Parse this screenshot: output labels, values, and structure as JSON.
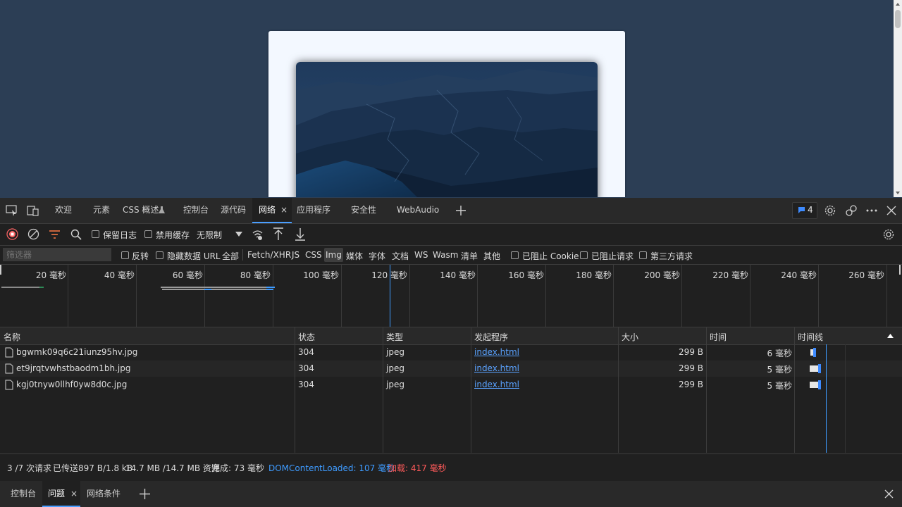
{
  "devtools": {
    "tabs": [
      {
        "label": "欢迎"
      },
      {
        "label": "元素"
      },
      {
        "label": "CSS 概述"
      },
      {
        "label": "控制台"
      },
      {
        "label": "源代码"
      },
      {
        "label": "网络",
        "active": true
      },
      {
        "label": "应用程序"
      },
      {
        "label": "安全性"
      },
      {
        "label": "WebAudio"
      }
    ],
    "issues_count": "4",
    "close_tab_symbol": "×"
  },
  "network_toolbar": {
    "preserve_log": "保留日志",
    "disable_cache": "禁用缓存",
    "throttling": "无限制"
  },
  "filter_bar": {
    "placeholder": "筛选器",
    "invert": "反转",
    "hide_data_urls": "隐藏数据 URL",
    "types": [
      "全部",
      "Fetch/XHR",
      "JS",
      "CSS",
      "Img",
      "媒体",
      "字体",
      "文档",
      "WS",
      "Wasm",
      "清单",
      "其他"
    ],
    "active_type": "Img",
    "blocked_cookies": "已阻止 Cookie",
    "blocked_requests": "已阻止请求",
    "third_party": "第三方请求"
  },
  "overview": {
    "tick_labels": [
      "20 毫秒",
      "40 毫秒",
      "60 毫秒",
      "80 毫秒",
      "100 毫秒",
      "120 毫秒",
      "140 毫秒",
      "160 毫秒",
      "180 毫秒",
      "200 毫秒",
      "220 毫秒",
      "240 毫秒",
      "260 毫秒"
    ]
  },
  "table": {
    "headers": {
      "name": "名称",
      "status": "状态",
      "type": "类型",
      "initiator": "发起程序",
      "size": "大小",
      "time": "时间",
      "waterfall": "时间线"
    },
    "rows": [
      {
        "name": "bgwmk09q6c21iunz95hv.jpg",
        "status": "304",
        "type": "jpeg",
        "initiator": "index.html",
        "size": "299 B",
        "time": "6 毫秒"
      },
      {
        "name": "et9jrqtvwhstbaodm1bh.jpg",
        "status": "304",
        "type": "jpeg",
        "initiator": "index.html",
        "size": "299 B",
        "time": "5 毫秒"
      },
      {
        "name": "kgj0tnyw0llhf0yw8d0c.jpg",
        "status": "304",
        "type": "jpeg",
        "initiator": "index.html",
        "size": "299 B",
        "time": "5 毫秒"
      }
    ]
  },
  "status": {
    "requests": "3 /7 次请求",
    "transferred": "已传送897 B/1.8 kB",
    "resources": "14.7 MB /14.7 MB 资源",
    "finish": "完成: 73 毫秒",
    "dom_content_loaded": "DOMContentLoaded: 107 毫秒",
    "load": "加载: 417 毫秒",
    "dcl_color": "#3e9bff",
    "load_color": "#ff5a5a"
  },
  "drawer": {
    "tabs": [
      {
        "label": "控制台"
      },
      {
        "label": "问题",
        "active": true
      },
      {
        "label": "网络条件"
      }
    ]
  }
}
